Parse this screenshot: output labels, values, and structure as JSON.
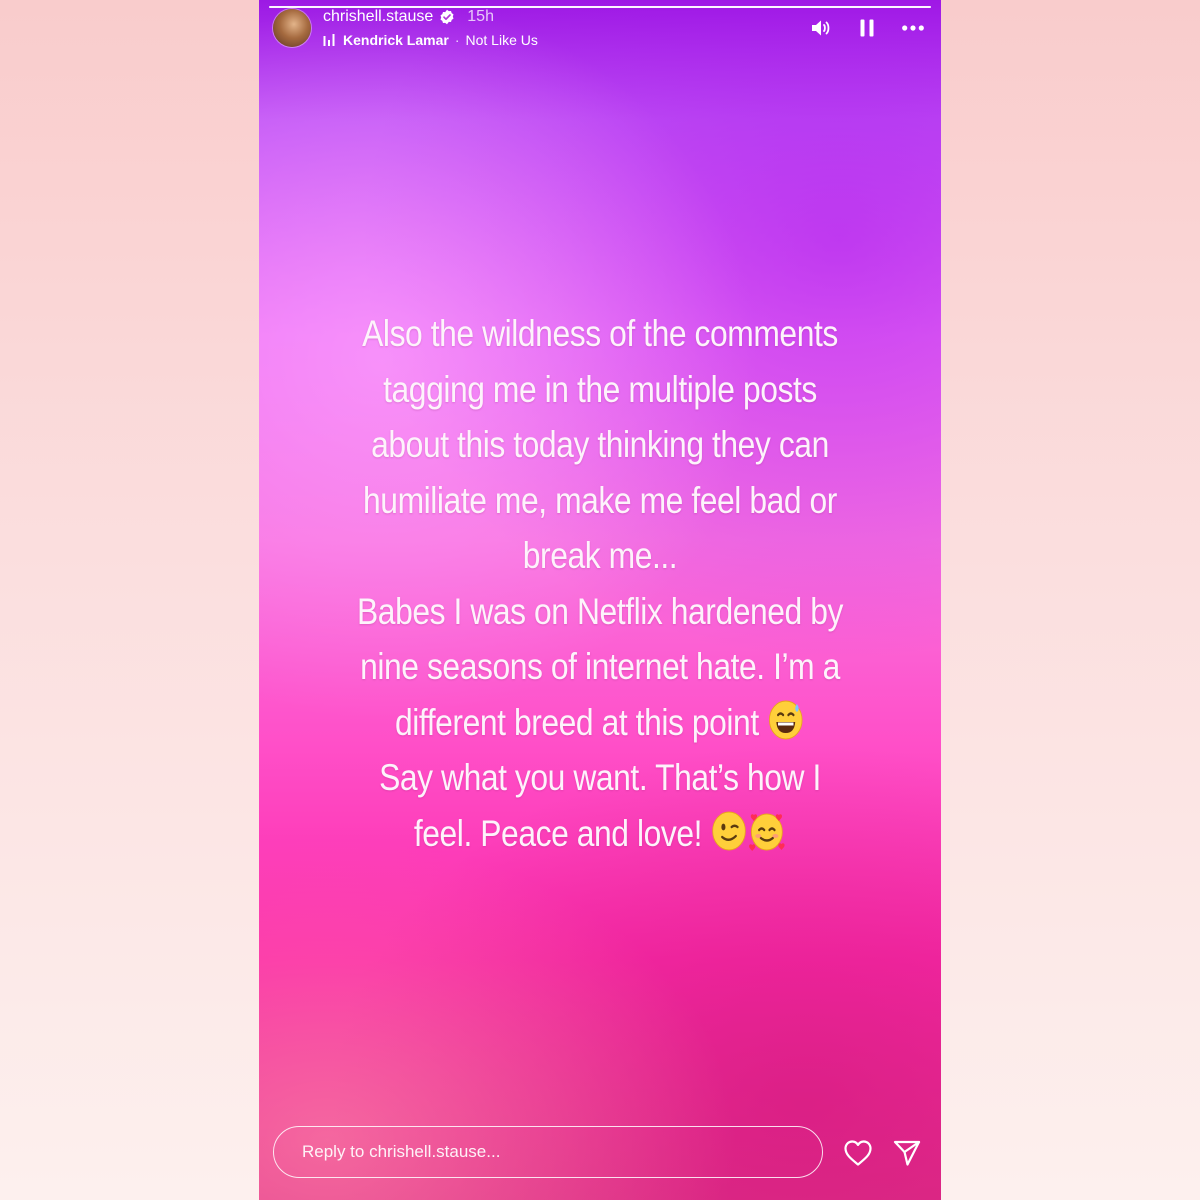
{
  "story": {
    "progress": 1.0
  },
  "header": {
    "username": "chrishell.stause",
    "time_ago": "15h",
    "music": {
      "artist": "Kendrick Lamar",
      "separator": "·",
      "song": "Not Like Us"
    },
    "icons": {
      "verified": "verified-badge-icon",
      "music": "music-bars-icon",
      "sound": "speaker-icon",
      "pause": "pause-icon",
      "more": "more-options-icon"
    }
  },
  "caption": {
    "lines": [
      "Also the wildness of the comments",
      "tagging me in the multiple posts",
      "about this today thinking they can",
      "humiliate me, make me feel bad or",
      "break me...",
      "Babes I was on Netflix hardened by",
      "nine seasons of internet hate. I’m a",
      "different breed at this point",
      "Say what you want. That’s how I",
      "feel. Peace and love!"
    ],
    "emojis": [
      "grinning-face-with-sweat",
      "winking-face",
      "smiling-face-with-hearts"
    ]
  },
  "footer": {
    "reply_placeholder": "Reply to chrishell.stause...",
    "icons": {
      "like": "heart-icon",
      "share": "send-icon"
    }
  },
  "colors": {
    "page_background_top": "#f9cccc",
    "page_background_bottom": "#fdf0ee",
    "story_gradient_top": "#9c19e4",
    "story_gradient_mid": "#f873e0",
    "story_gradient_bottom": "#e2308a",
    "text": "#ffffff"
  }
}
